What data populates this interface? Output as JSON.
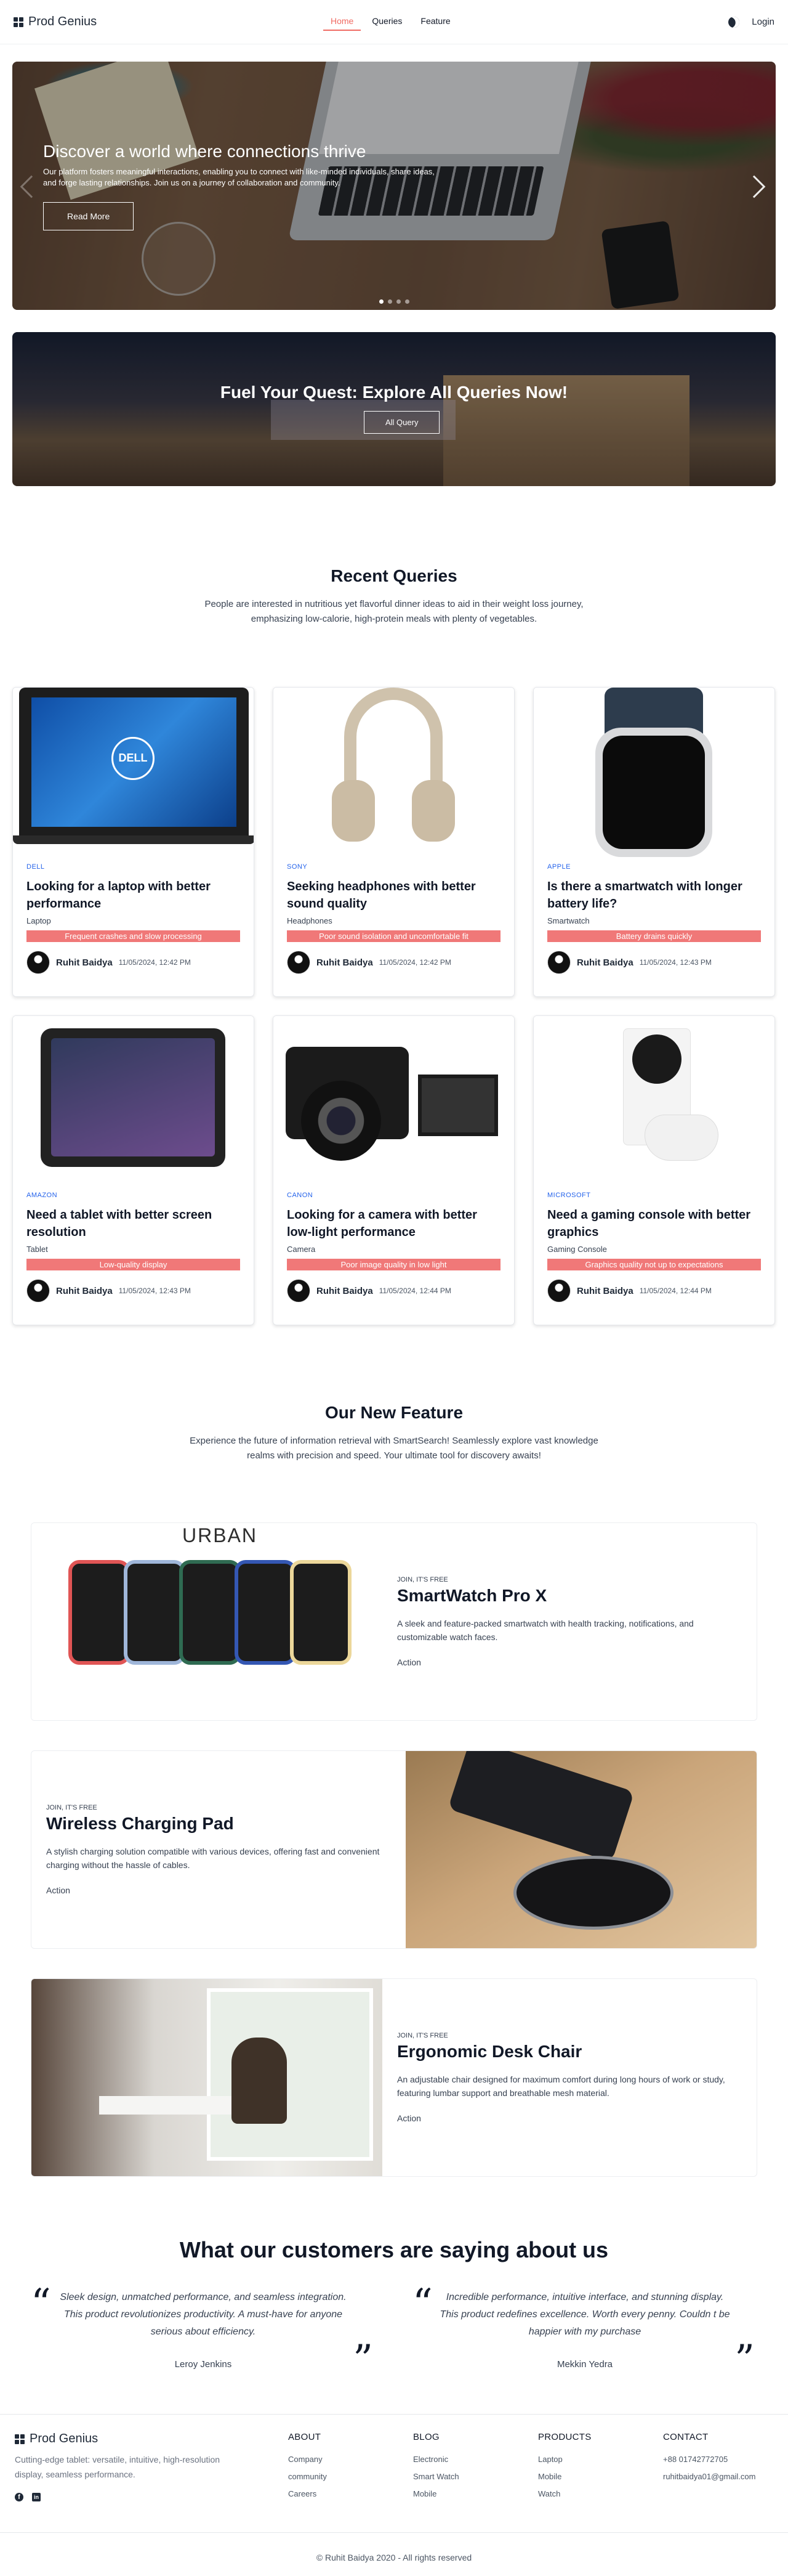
{
  "nav": {
    "brand": "Prod Genius",
    "links": [
      "Home",
      "Queries",
      "Feature"
    ],
    "login": "Login"
  },
  "hero": {
    "title": "Discover a world where connections thrive",
    "description": "Our platform fosters meaningful interactions, enabling you to connect with like-minded individuals, share ideas, and forge lasting relationships. Join us on a journey of collaboration and community.",
    "button": "Read More",
    "slide_count": 4,
    "active_slide": 1
  },
  "banner": {
    "title": "Fuel Your Quest: Explore All Queries Now!",
    "button": "All Query"
  },
  "recent": {
    "title": "Recent Queries",
    "subtitle": "People are interested in nutritious yet flavorful dinner ideas to aid in their weight loss journey, emphasizing low-calorie, high-protein meals with plenty of vegetables.",
    "cards": [
      {
        "brand": "DELL",
        "title": "Looking for a laptop with better performance",
        "category": "Laptop",
        "issue": "Frequent crashes and slow processing",
        "author": "Ruhit Baidya",
        "time": "11/05/2024, 12:42 PM"
      },
      {
        "brand": "SONY",
        "title": "Seeking headphones with better sound quality",
        "category": "Headphones",
        "issue": "Poor sound isolation and uncomfortable fit",
        "author": "Ruhit Baidya",
        "time": "11/05/2024, 12:42 PM"
      },
      {
        "brand": "APPLE",
        "title": "Is there a smartwatch with longer battery life?",
        "category": "Smartwatch",
        "issue": "Battery drains quickly",
        "author": "Ruhit Baidya",
        "time": "11/05/2024, 12:43 PM"
      },
      {
        "brand": "AMAZON",
        "title": "Need a tablet with better screen resolution",
        "category": "Tablet",
        "issue": "Low-quality display",
        "author": "Ruhit Baidya",
        "time": "11/05/2024, 12:43 PM"
      },
      {
        "brand": "CANON",
        "title": "Looking for a camera with better low-light performance",
        "category": "Camera",
        "issue": "Poor image quality in low light",
        "author": "Ruhit Baidya",
        "time": "11/05/2024, 12:44 PM"
      },
      {
        "brand": "MICROSOFT",
        "title": "Need a gaming console with better graphics",
        "category": "Gaming Console",
        "issue": "Graphics quality not up to expectations",
        "author": "Ruhit Baidya",
        "time": "11/05/2024, 12:44 PM"
      }
    ],
    "dell_logo": "DELL"
  },
  "features": {
    "title": "Our New Feature",
    "subtitle": "Experience the future of information retrieval with SmartSearch! Seamlessly explore vast knowledge realms with precision and speed. Your ultimate tool for discovery awaits!",
    "items": [
      {
        "kicker": "JOIN, IT'S FREE",
        "title": "SmartWatch Pro X",
        "description": "A sleek and feature-packed smartwatch with health tracking, notifications, and customizable watch faces.",
        "action": "Action"
      },
      {
        "kicker": "JOIN, IT'S FREE",
        "title": "Wireless Charging Pad",
        "description": "A stylish charging solution compatible with various devices, offering fast and convenient charging without the hassle of cables.",
        "action": "Action"
      },
      {
        "kicker": "JOIN, IT'S FREE",
        "title": "Ergonomic Desk Chair",
        "description": "An adjustable chair designed for maximum comfort during long hours of work or study, featuring lumbar support and breathable mesh material.",
        "action": "Action"
      }
    ],
    "watch_brand": "URBAN"
  },
  "testimonials": {
    "title": "What our customers are saying about us",
    "items": [
      {
        "text": "Sleek design, unmatched performance, and seamless integration. This product revolutionizes productivity. A must-have for anyone serious about efficiency.",
        "name": "Leroy Jenkins"
      },
      {
        "text": "Incredible performance, intuitive interface, and stunning display. This product redefines excellence. Worth every penny. Couldn t be happier with my purchase",
        "name": "Mekkin Yedra"
      }
    ]
  },
  "footer": {
    "brand": "Prod Genius",
    "tagline": "Cutting-edge tablet: versatile, intuitive, high-resolution display, seamless performance.",
    "columns": [
      {
        "title": "ABOUT",
        "items": [
          "Company",
          "community",
          "Careers"
        ]
      },
      {
        "title": "BLOG",
        "items": [
          "Electronic",
          "Smart Watch",
          "Mobile"
        ]
      },
      {
        "title": "PRODUCTS",
        "items": [
          "Laptop",
          "Mobile",
          "Watch"
        ]
      },
      {
        "title": "CONTACT",
        "items": [
          "+88 01742772705",
          "ruhitbaidya01@gmail.com"
        ]
      }
    ],
    "copyright": "© Ruhit Baidya 2020 - All rights reserved"
  },
  "colors": {
    "accent": "#f06b63",
    "issue_badge": "#f07878",
    "brand_link": "#2563eb"
  }
}
